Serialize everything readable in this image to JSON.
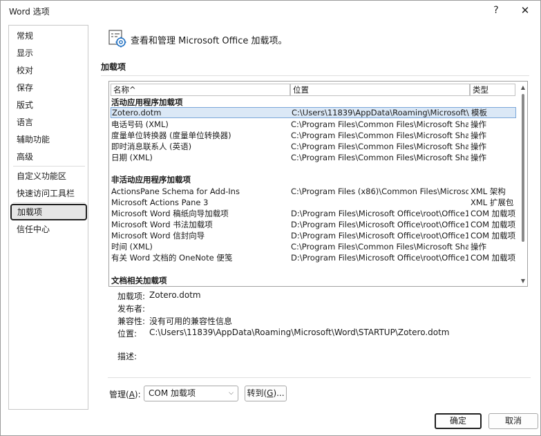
{
  "window": {
    "title": "Word 选项",
    "help": "?",
    "close": "✕"
  },
  "sidebar": {
    "items": [
      {
        "label": "常规"
      },
      {
        "label": "显示"
      },
      {
        "label": "校对"
      },
      {
        "label": "保存"
      },
      {
        "label": "版式"
      },
      {
        "label": "语言"
      },
      {
        "label": "辅助功能"
      },
      {
        "label": "高级"
      },
      {
        "label": "自定义功能区"
      },
      {
        "label": "快速访问工具栏"
      },
      {
        "label": "加载项"
      },
      {
        "label": "信任中心"
      }
    ],
    "active_label": "加载项"
  },
  "header": {
    "title": "查看和管理 Microsoft Office 加载项。",
    "section": "加载项"
  },
  "list": {
    "columns": [
      "名称^",
      "位置",
      "类型"
    ],
    "groups": [
      {
        "title": "活动应用程序加载项",
        "rows": [
          [
            "Zotero.dotm",
            "C:\\Users\\11839\\AppData\\Roaming\\Microsoft\\",
            "模板"
          ],
          [
            "电话号码 (XML)",
            "C:\\Program Files\\Common Files\\Microsoft Shar",
            "操作"
          ],
          [
            "度量单位转换器 (度量单位转换器)",
            "C:\\Program Files\\Common Files\\Microsoft Shar",
            "操作"
          ],
          [
            "即时消息联系人 (英语)",
            "C:\\Program Files\\Common Files\\Microsoft Shar",
            "操作"
          ],
          [
            "日期 (XML)",
            "C:\\Program Files\\Common Files\\Microsoft Shar",
            "操作"
          ]
        ]
      },
      {
        "title": "非活动应用程序加载项",
        "rows": [
          [
            "ActionsPane Schema for Add-Ins",
            "C:\\Program Files (x86)\\Common Files\\Microsof",
            "XML 架构"
          ],
          [
            "Microsoft Actions Pane 3",
            "",
            "XML 扩展包"
          ],
          [
            "Microsoft Word 稿纸向导加载项",
            "D:\\Program Files\\Microsoft Office\\root\\Office1",
            "COM 加载项"
          ],
          [
            "Microsoft Word 书法加载项",
            "D:\\Program Files\\Microsoft Office\\root\\Office1",
            "COM 加载项"
          ],
          [
            "Microsoft Word 信封向导",
            "D:\\Program Files\\Microsoft Office\\root\\Office1",
            "COM 加载项"
          ],
          [
            "时间 (XML)",
            "C:\\Program Files\\Common Files\\Microsoft Shar",
            "操作"
          ],
          [
            "有关 Word 文档的 OneNote 便笺",
            "D:\\Program Files\\Microsoft Office\\root\\Office1",
            "COM 加载项"
          ]
        ]
      },
      {
        "title": "文档相关加载项",
        "rows": []
      }
    ],
    "selected_row": "Zotero.dotm"
  },
  "details": {
    "addin_label": "加载项:",
    "addin_value": "Zotero.dotm",
    "publisher_label": "发布者:",
    "publisher_value": "",
    "compat_label": "兼容性:",
    "compat_value": "没有可用的兼容性信息",
    "location_label": "位置:",
    "location_value": "C:\\Users\\11839\\AppData\\Roaming\\Microsoft\\Word\\STARTUP\\Zotero.dotm",
    "desc_label": "描述:",
    "desc_value": ""
  },
  "manage": {
    "label_pre": "管理(",
    "label_key": "A",
    "label_post": "):",
    "selected": "COM 加载项",
    "goto_pre": "转到(",
    "goto_key": "G",
    "goto_post": ")..."
  },
  "footer": {
    "ok": "确定",
    "cancel": "取消"
  },
  "colors": {
    "selection_bg": "#dbe8f6",
    "selection_border": "#7aa7d9",
    "active_nav_bg": "#e6e6e6"
  },
  "icons": {
    "header_icon": "addin-gear-icon",
    "sort_icon": "sort-ascending-icon",
    "dropdown_icon": "chevron-down-icon"
  }
}
